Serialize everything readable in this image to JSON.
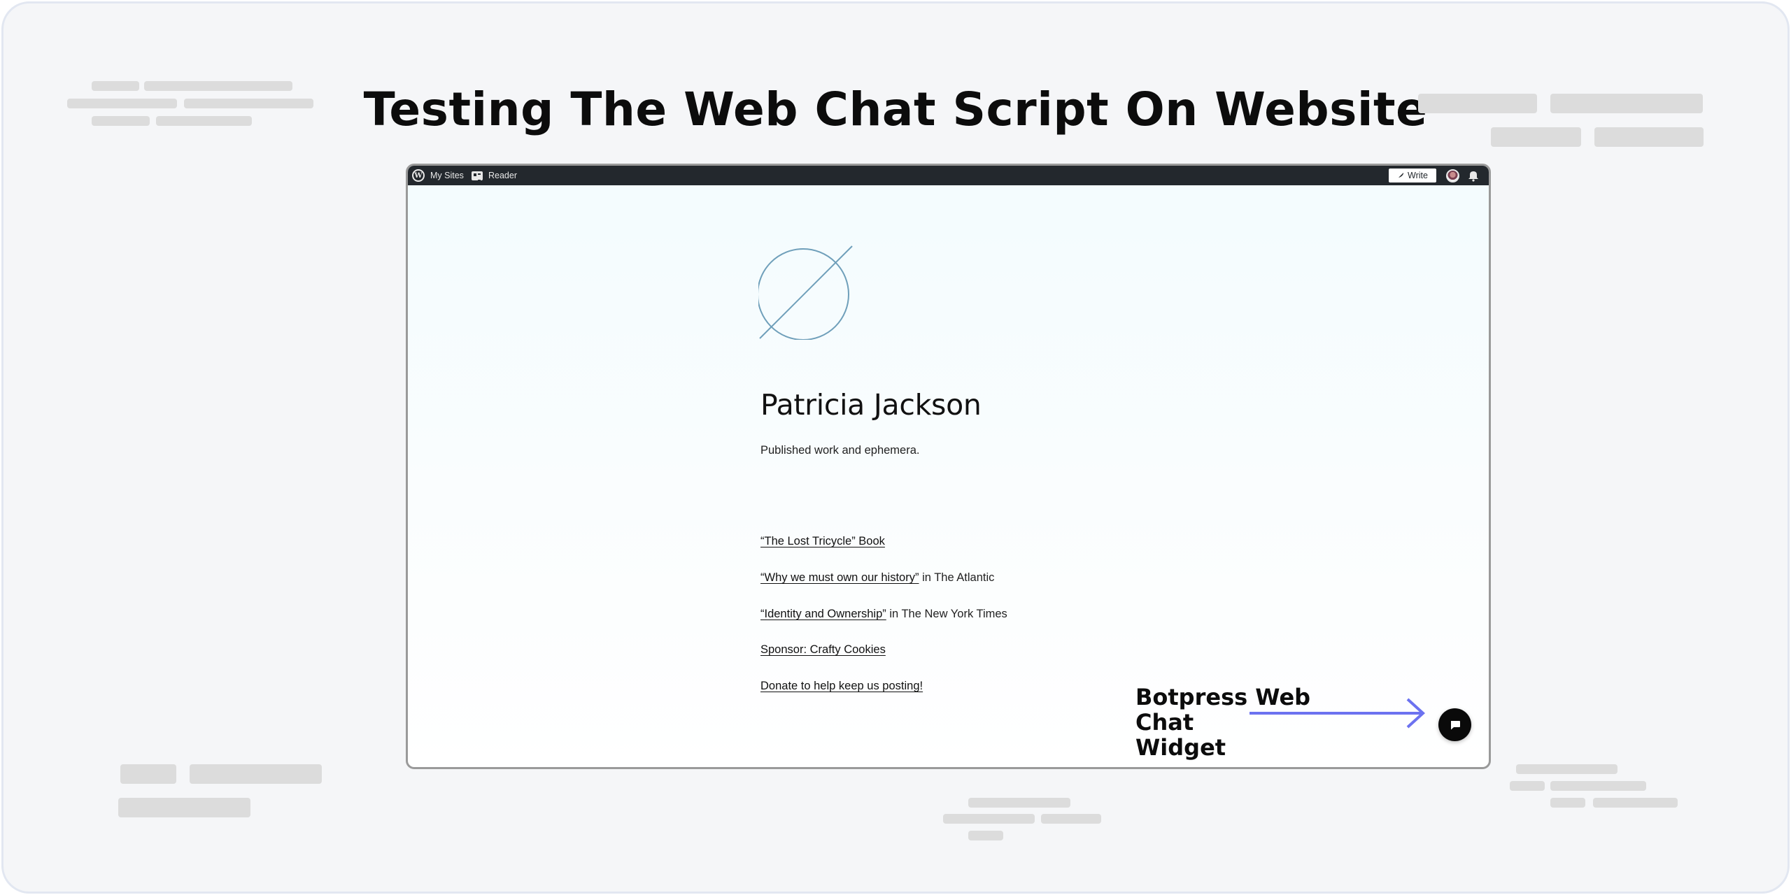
{
  "headline": "Testing The Web Chat Script On Website",
  "admin_bar": {
    "my_sites": "My Sites",
    "reader": "Reader",
    "write": "Write",
    "background": "#23282d"
  },
  "site": {
    "title": "Patricia Jackson",
    "tagline": "Published work and ephemera.",
    "links": [
      {
        "link_text": "“The Lost Tricycle” Book",
        "suffix": ""
      },
      {
        "link_text": "“Why we must own our history”",
        "suffix": " in The Atlantic"
      },
      {
        "link_text": "“Identity and Ownership”",
        "suffix": " in The New York Times"
      },
      {
        "link_text": "Sponsor: Crafty Cookies",
        "suffix": ""
      },
      {
        "link_text": "Donate to help keep us posting!",
        "suffix": ""
      }
    ]
  },
  "annotation": {
    "line1": "Botpress Web Chat",
    "line2": "Widget",
    "arrow_color": "#6c72f0"
  },
  "chat_widget": {
    "icon": "chat-bubble-icon",
    "background": "#0a0a0a"
  }
}
